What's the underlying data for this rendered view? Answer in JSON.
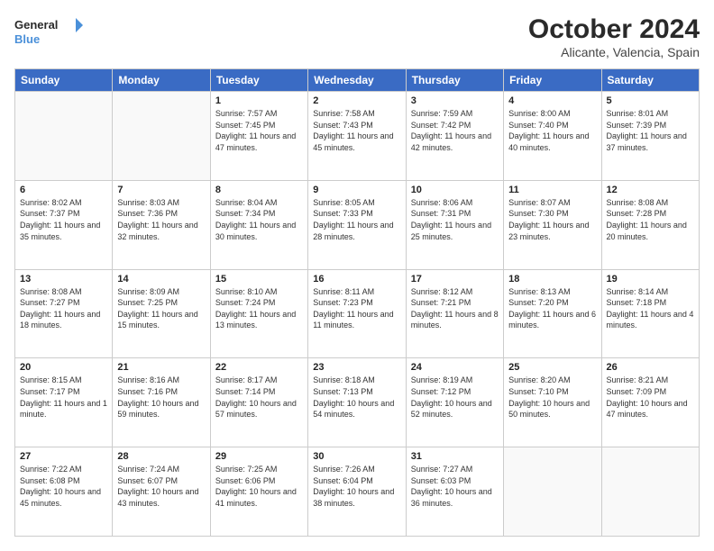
{
  "header": {
    "logo_line1": "General",
    "logo_line2": "Blue",
    "month": "October 2024",
    "location": "Alicante, Valencia, Spain"
  },
  "days_of_week": [
    "Sunday",
    "Monday",
    "Tuesday",
    "Wednesday",
    "Thursday",
    "Friday",
    "Saturday"
  ],
  "weeks": [
    [
      {
        "day": "",
        "info": ""
      },
      {
        "day": "",
        "info": ""
      },
      {
        "day": "1",
        "info": "Sunrise: 7:57 AM\nSunset: 7:45 PM\nDaylight: 11 hours and 47 minutes."
      },
      {
        "day": "2",
        "info": "Sunrise: 7:58 AM\nSunset: 7:43 PM\nDaylight: 11 hours and 45 minutes."
      },
      {
        "day": "3",
        "info": "Sunrise: 7:59 AM\nSunset: 7:42 PM\nDaylight: 11 hours and 42 minutes."
      },
      {
        "day": "4",
        "info": "Sunrise: 8:00 AM\nSunset: 7:40 PM\nDaylight: 11 hours and 40 minutes."
      },
      {
        "day": "5",
        "info": "Sunrise: 8:01 AM\nSunset: 7:39 PM\nDaylight: 11 hours and 37 minutes."
      }
    ],
    [
      {
        "day": "6",
        "info": "Sunrise: 8:02 AM\nSunset: 7:37 PM\nDaylight: 11 hours and 35 minutes."
      },
      {
        "day": "7",
        "info": "Sunrise: 8:03 AM\nSunset: 7:36 PM\nDaylight: 11 hours and 32 minutes."
      },
      {
        "day": "8",
        "info": "Sunrise: 8:04 AM\nSunset: 7:34 PM\nDaylight: 11 hours and 30 minutes."
      },
      {
        "day": "9",
        "info": "Sunrise: 8:05 AM\nSunset: 7:33 PM\nDaylight: 11 hours and 28 minutes."
      },
      {
        "day": "10",
        "info": "Sunrise: 8:06 AM\nSunset: 7:31 PM\nDaylight: 11 hours and 25 minutes."
      },
      {
        "day": "11",
        "info": "Sunrise: 8:07 AM\nSunset: 7:30 PM\nDaylight: 11 hours and 23 minutes."
      },
      {
        "day": "12",
        "info": "Sunrise: 8:08 AM\nSunset: 7:28 PM\nDaylight: 11 hours and 20 minutes."
      }
    ],
    [
      {
        "day": "13",
        "info": "Sunrise: 8:08 AM\nSunset: 7:27 PM\nDaylight: 11 hours and 18 minutes."
      },
      {
        "day": "14",
        "info": "Sunrise: 8:09 AM\nSunset: 7:25 PM\nDaylight: 11 hours and 15 minutes."
      },
      {
        "day": "15",
        "info": "Sunrise: 8:10 AM\nSunset: 7:24 PM\nDaylight: 11 hours and 13 minutes."
      },
      {
        "day": "16",
        "info": "Sunrise: 8:11 AM\nSunset: 7:23 PM\nDaylight: 11 hours and 11 minutes."
      },
      {
        "day": "17",
        "info": "Sunrise: 8:12 AM\nSunset: 7:21 PM\nDaylight: 11 hours and 8 minutes."
      },
      {
        "day": "18",
        "info": "Sunrise: 8:13 AM\nSunset: 7:20 PM\nDaylight: 11 hours and 6 minutes."
      },
      {
        "day": "19",
        "info": "Sunrise: 8:14 AM\nSunset: 7:18 PM\nDaylight: 11 hours and 4 minutes."
      }
    ],
    [
      {
        "day": "20",
        "info": "Sunrise: 8:15 AM\nSunset: 7:17 PM\nDaylight: 11 hours and 1 minute."
      },
      {
        "day": "21",
        "info": "Sunrise: 8:16 AM\nSunset: 7:16 PM\nDaylight: 10 hours and 59 minutes."
      },
      {
        "day": "22",
        "info": "Sunrise: 8:17 AM\nSunset: 7:14 PM\nDaylight: 10 hours and 57 minutes."
      },
      {
        "day": "23",
        "info": "Sunrise: 8:18 AM\nSunset: 7:13 PM\nDaylight: 10 hours and 54 minutes."
      },
      {
        "day": "24",
        "info": "Sunrise: 8:19 AM\nSunset: 7:12 PM\nDaylight: 10 hours and 52 minutes."
      },
      {
        "day": "25",
        "info": "Sunrise: 8:20 AM\nSunset: 7:10 PM\nDaylight: 10 hours and 50 minutes."
      },
      {
        "day": "26",
        "info": "Sunrise: 8:21 AM\nSunset: 7:09 PM\nDaylight: 10 hours and 47 minutes."
      }
    ],
    [
      {
        "day": "27",
        "info": "Sunrise: 7:22 AM\nSunset: 6:08 PM\nDaylight: 10 hours and 45 minutes."
      },
      {
        "day": "28",
        "info": "Sunrise: 7:24 AM\nSunset: 6:07 PM\nDaylight: 10 hours and 43 minutes."
      },
      {
        "day": "29",
        "info": "Sunrise: 7:25 AM\nSunset: 6:06 PM\nDaylight: 10 hours and 41 minutes."
      },
      {
        "day": "30",
        "info": "Sunrise: 7:26 AM\nSunset: 6:04 PM\nDaylight: 10 hours and 38 minutes."
      },
      {
        "day": "31",
        "info": "Sunrise: 7:27 AM\nSunset: 6:03 PM\nDaylight: 10 hours and 36 minutes."
      },
      {
        "day": "",
        "info": ""
      },
      {
        "day": "",
        "info": ""
      }
    ]
  ]
}
